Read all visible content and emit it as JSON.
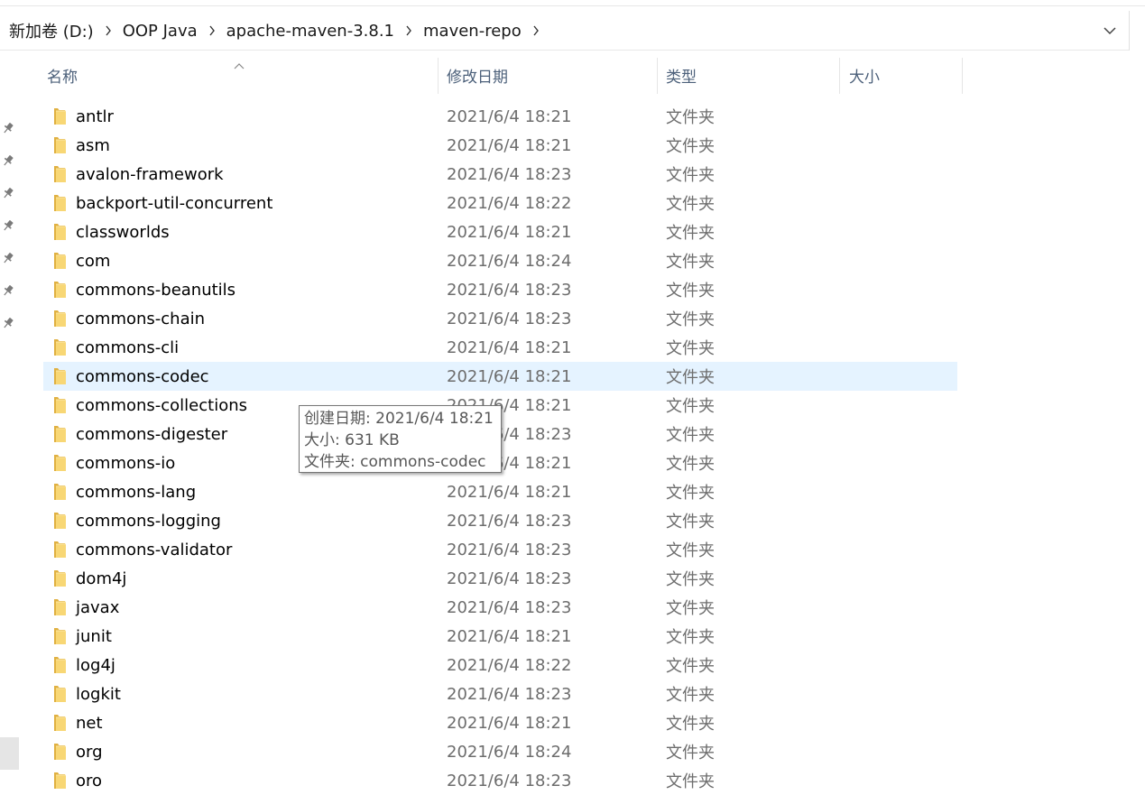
{
  "breadcrumb": [
    "新加卷 (D:)",
    "OOP Java",
    "apache-maven-3.8.1",
    "maven-repo"
  ],
  "icons": {
    "separator": "chevron-right-icon",
    "address_dropdown": "chevron-down-icon",
    "pin": "pin-icon",
    "folder": "folder-icon",
    "sort": "sort-ascending-icon"
  },
  "columns": {
    "name": "名称",
    "date": "修改日期",
    "type": "类型",
    "size": "大小"
  },
  "files": [
    {
      "name": "antlr",
      "date": "2021/6/4 18:21",
      "type": "文件夹"
    },
    {
      "name": "asm",
      "date": "2021/6/4 18:21",
      "type": "文件夹"
    },
    {
      "name": "avalon-framework",
      "date": "2021/6/4 18:23",
      "type": "文件夹"
    },
    {
      "name": "backport-util-concurrent",
      "date": "2021/6/4 18:22",
      "type": "文件夹"
    },
    {
      "name": "classworlds",
      "date": "2021/6/4 18:21",
      "type": "文件夹"
    },
    {
      "name": "com",
      "date": "2021/6/4 18:24",
      "type": "文件夹"
    },
    {
      "name": "commons-beanutils",
      "date": "2021/6/4 18:23",
      "type": "文件夹"
    },
    {
      "name": "commons-chain",
      "date": "2021/6/4 18:23",
      "type": "文件夹"
    },
    {
      "name": "commons-cli",
      "date": "2021/6/4 18:21",
      "type": "文件夹"
    },
    {
      "name": "commons-codec",
      "date": "2021/6/4 18:21",
      "type": "文件夹",
      "hovered": true
    },
    {
      "name": "commons-collections",
      "date": "2021/6/4 18:21",
      "type": "文件夹"
    },
    {
      "name": "commons-digester",
      "date": "2021/6/4 18:23",
      "type": "文件夹"
    },
    {
      "name": "commons-io",
      "date": "2021/6/4 18:21",
      "type": "文件夹"
    },
    {
      "name": "commons-lang",
      "date": "2021/6/4 18:21",
      "type": "文件夹"
    },
    {
      "name": "commons-logging",
      "date": "2021/6/4 18:23",
      "type": "文件夹"
    },
    {
      "name": "commons-validator",
      "date": "2021/6/4 18:23",
      "type": "文件夹"
    },
    {
      "name": "dom4j",
      "date": "2021/6/4 18:23",
      "type": "文件夹"
    },
    {
      "name": "javax",
      "date": "2021/6/4 18:23",
      "type": "文件夹"
    },
    {
      "name": "junit",
      "date": "2021/6/4 18:21",
      "type": "文件夹"
    },
    {
      "name": "log4j",
      "date": "2021/6/4 18:22",
      "type": "文件夹"
    },
    {
      "name": "logkit",
      "date": "2021/6/4 18:23",
      "type": "文件夹"
    },
    {
      "name": "net",
      "date": "2021/6/4 18:21",
      "type": "文件夹"
    },
    {
      "name": "org",
      "date": "2021/6/4 18:24",
      "type": "文件夹"
    },
    {
      "name": "oro",
      "date": "2021/6/4 18:23",
      "type": "文件夹"
    }
  ],
  "tooltip": {
    "created": "创建日期: 2021/6/4 18:21",
    "size": "大小: 631 KB",
    "folder": "文件夹: commons-codec"
  },
  "colors": {
    "hover_row": "#e5f3ff",
    "folder_fill": "#f8d775",
    "header_text": "#4c607a",
    "secondary_text": "#6d6d6d"
  }
}
